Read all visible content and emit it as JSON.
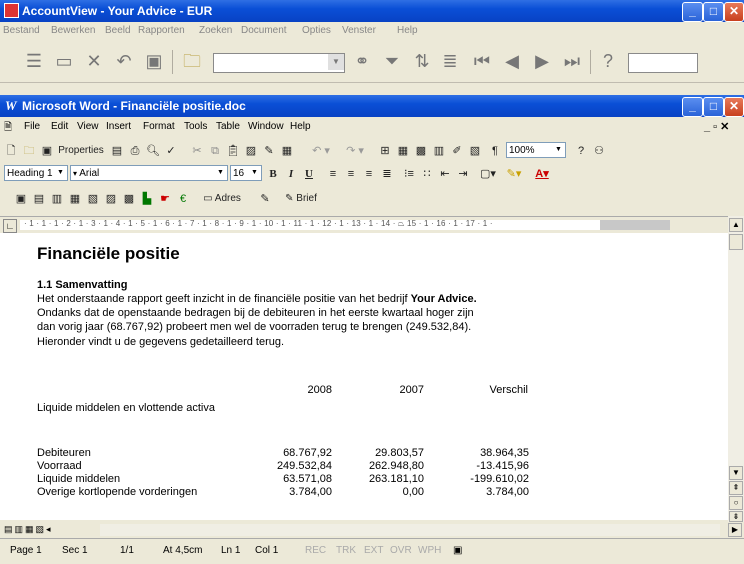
{
  "outer_window": {
    "title": "AccountView - Your Advice - EUR",
    "menu": [
      "Bestand",
      "Bewerken",
      "Beeld",
      "Rapporten",
      "Zoeken",
      "Document",
      "Opties",
      "Venster",
      "Help"
    ]
  },
  "word_window": {
    "title": "Microsoft Word - Financiële positie.doc",
    "menu": [
      "File",
      "Edit",
      "View",
      "Insert",
      "Format",
      "Tools",
      "Table",
      "Window",
      "Help"
    ],
    "toolbar": {
      "properties_label": "Properties",
      "zoom": "100%",
      "style": "Heading 1",
      "font": "Arial",
      "font_size": "16",
      "adres_label": "Adres",
      "brief_label": "Brief"
    }
  },
  "document": {
    "heading": "Financiële positie",
    "section_title": "1.1  Samenvatting",
    "paragraph_lines": [
      "Het onderstaande rapport geeft inzicht in de financiële positie van het bedrijf ",
      "Ondanks dat de openstaande bedragen bij de debiteuren in het eerste kwartaal hoger zijn",
      "dan vorig jaar (68.767,92) probeert men wel de voorraden terug te brengen (249.532,84).",
      "Hieronder vindt u de gegevens gedetailleerd terug."
    ],
    "company_name": "Your Advice.",
    "table": {
      "headers": [
        "2008",
        "2007",
        "Verschil"
      ],
      "section_label": "Liquide middelen en vlottende activa",
      "rows": [
        {
          "label": "Debiteuren",
          "v2008": "68.767,92",
          "v2007": "29.803,57",
          "diff": "38.964,35"
        },
        {
          "label": "Voorraad",
          "v2008": "249.532,84",
          "v2007": "262.948,80",
          "diff": "-13.415,96"
        },
        {
          "label": "Liquide middelen",
          "v2008": "63.571,08",
          "v2007": "263.181,10",
          "diff": "-199.610,02"
        },
        {
          "label": "Overige kortlopende vorderingen",
          "v2008": "3.784,00",
          "v2007": "0,00",
          "diff": "3.784,00"
        }
      ]
    }
  },
  "status": {
    "page": "Page 1",
    "sec": "Sec 1",
    "pages": "1/1",
    "at": "At 4,5cm",
    "ln": "Ln 1",
    "col": "Col 1",
    "rec": "REC",
    "trk": "TRK",
    "ext": "EXT",
    "ovr": "OVR",
    "wph": "WPH"
  },
  "ruler_text": "· 1 · 1 · 1 · 2 · 1 · 3 · 1 · 4 · 1 · 5 · 1 · 6 · 1 · 7 · 1 · 8 · 1 · 9 · 1 · 10 · 1 · 11 · 1 · 12 · 1 · 13 · 1 · 14 · ⏢ 15 · 1 · 16 · 1 · 17 · 1 ·"
}
